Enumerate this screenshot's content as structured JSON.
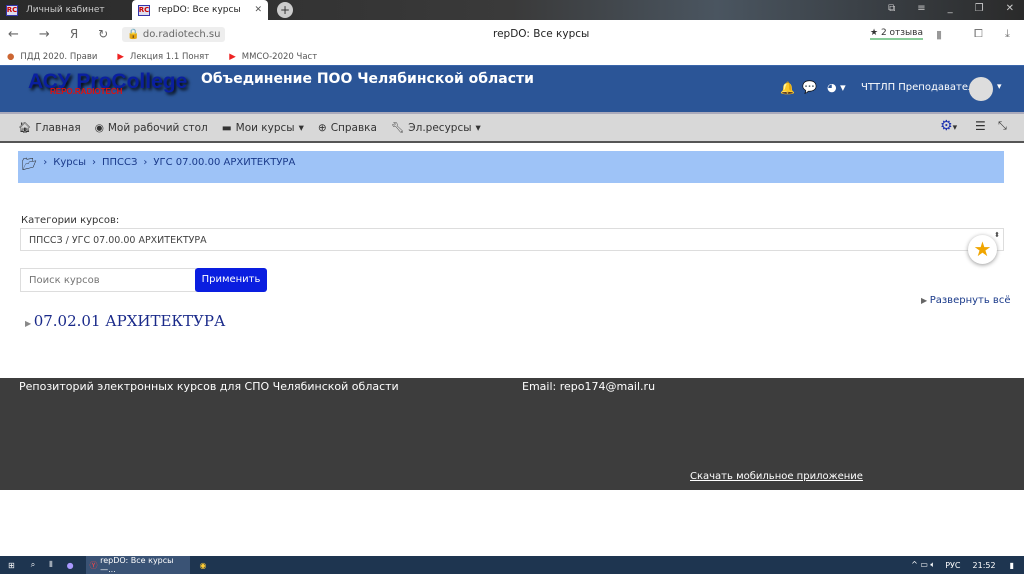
{
  "browser": {
    "tabs": [
      {
        "label": "Личный кабинет",
        "active": false
      },
      {
        "label": "repDO: Все курсы",
        "active": true
      }
    ],
    "url": "do.radiotech.su",
    "page_title": "repDO: Все курсы",
    "reviews": "2 отзыва",
    "bookmarks": [
      "ПДД 2020. Прави",
      "Лекция 1.1 Понят",
      "ММСО-2020 Част"
    ]
  },
  "header": {
    "logo": "АСУ ProCollege",
    "logo_sub": "REPO.RADIOTECH",
    "site_title": "Объединение ПОО Челябинской области",
    "user": "ЧТТЛП Преподаватель"
  },
  "nav": {
    "items": [
      "Главная",
      "Мой рабочий стол",
      "Мои курсы",
      "Справка",
      "Эл.ресурсы"
    ]
  },
  "breadcrumb": [
    "Курсы",
    "ППССЗ",
    "УГС 07.00.00 АРХИТЕКТУРА"
  ],
  "main": {
    "category_label": "Категории курсов:",
    "category_value": "ППССЗ / УГС 07.00.00 АРХИТЕКТУРА",
    "search_placeholder": "Поиск курсов",
    "apply": "Применить",
    "expand_all": "Развернуть всё",
    "course": "07.02.01 АРХИТЕКТУРА"
  },
  "footer": {
    "text": "Репозиторий электронных курсов для СПО Челябинской области",
    "email": "Email: repo174@mail.ru",
    "app_link": "Скачать мобильное приложение"
  },
  "taskbar": {
    "app": "repDO: Все курсы —...",
    "lang": "РУС",
    "time": "21:52"
  }
}
